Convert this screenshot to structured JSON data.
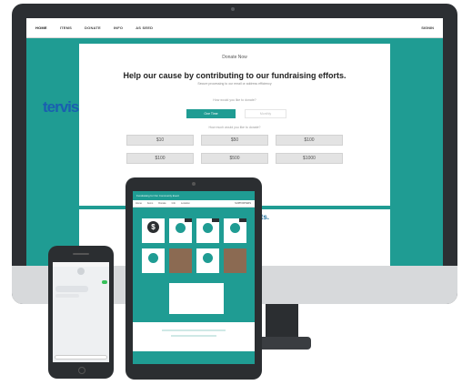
{
  "desktop": {
    "nav": {
      "items": [
        "HOME",
        "ITEMS",
        "DONATE",
        "INFO",
        "AS SEED"
      ],
      "right": "SIGNIN"
    },
    "donate_title": "Donate Now",
    "headline": "Help our cause by contributing to our fundraising efforts.",
    "subline": "Secure processing to our email or address efficiency",
    "question": "How would you like to donate?",
    "option_one": "One Time",
    "option_two": "Monthly",
    "amount_question": "How much would you like to donate?",
    "amounts": [
      "$10",
      "$50",
      "$100",
      "$100",
      "$500",
      "$1000"
    ],
    "events": "ule of Events."
  },
  "tablet": {
    "header_title": "Fundraising for Our Community Event",
    "nav_items": [
      "Home",
      "Items",
      "Donate",
      "Info",
      "Location"
    ],
    "nav_right": "SUPPORTERS",
    "dollar_symbol": "$",
    "logo_text": "tervis"
  },
  "colors": {
    "teal": "#1f9c93",
    "dark": "#2c2f33",
    "brand_blue": "#1a5fb0"
  }
}
